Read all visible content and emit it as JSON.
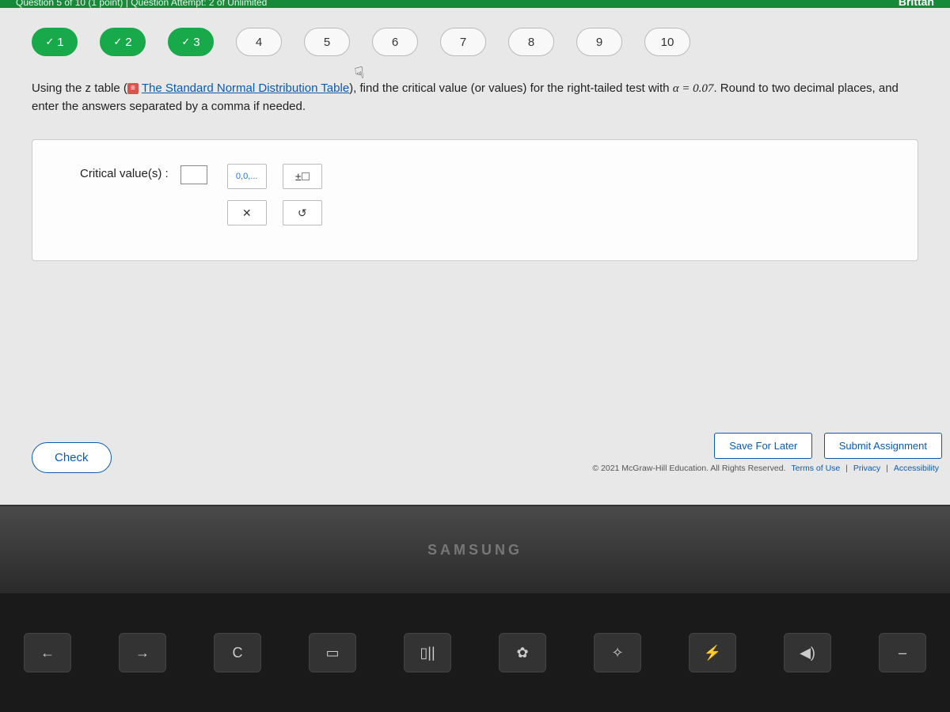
{
  "topbar": {
    "left_text": "Question 5 of 10 (1 point) | Question Attempt: 2 of Unlimited",
    "user": "Brittan"
  },
  "nav": [
    {
      "label": "1",
      "done": true
    },
    {
      "label": "2",
      "done": true
    },
    {
      "label": "3",
      "done": true
    },
    {
      "label": "4",
      "done": false
    },
    {
      "label": "5",
      "done": false
    },
    {
      "label": "6",
      "done": false
    },
    {
      "label": "7",
      "done": false
    },
    {
      "label": "8",
      "done": false
    },
    {
      "label": "9",
      "done": false
    },
    {
      "label": "10",
      "done": false
    }
  ],
  "question": {
    "pre_link": "Using the z table (",
    "link_text": "The Standard Normal Distribution Table",
    "post_link_a": "), find the critical value (or values) for the right-tailed test with ",
    "alpha_expr": "α = 0.07",
    "post_link_b": ". Round to two decimal places, and enter the answers separated by a comma if needed."
  },
  "answer": {
    "label": "Critical value(s) :",
    "value": "",
    "tool_format": "0,0,...",
    "tool_plusminus": "±□",
    "tool_clear": "✕",
    "tool_reset": "↺"
  },
  "actions": {
    "check": "Check",
    "save": "Save For Later",
    "submit": "Submit Assignment"
  },
  "footer": {
    "copyright": "© 2021 McGraw-Hill Education. All Rights Reserved.",
    "terms": "Terms of Use",
    "privacy": "Privacy",
    "accessibility": "Accessibility"
  },
  "device": {
    "brand": "SAMSUNG"
  },
  "keys": [
    "←",
    "→",
    "C",
    "▭",
    "▯||",
    "✿",
    "✧",
    "⚡",
    "◀)",
    "–"
  ],
  "symbols_row": [
    "&",
    "*",
    "(",
    ")"
  ]
}
